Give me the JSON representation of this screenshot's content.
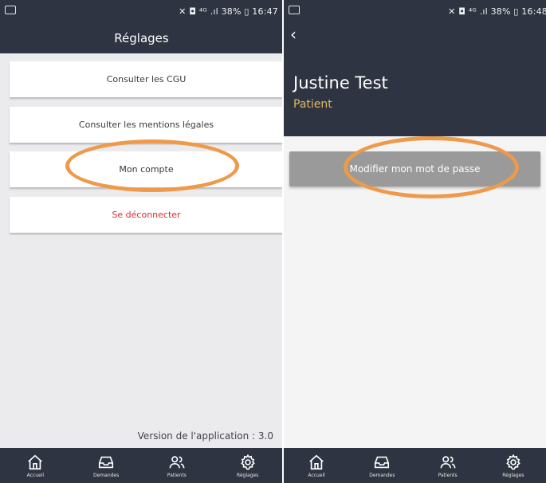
{
  "left": {
    "status": {
      "right": "✕ ◘ ⁴ᴳ .ıl 38% ▯ 16:47"
    },
    "title": "Réglages",
    "menu": [
      {
        "label": "Consulter les CGU"
      },
      {
        "label": "Consulter les mentions légales"
      },
      {
        "label": "Mon compte"
      },
      {
        "label": "Se déconnecter",
        "color": "#e02a2a"
      }
    ],
    "version": "Version de l'application : 3.0",
    "tabs": [
      {
        "label": "Accueil",
        "icon": "home-icon"
      },
      {
        "label": "Demandes",
        "icon": "inbox-icon"
      },
      {
        "label": "Patients",
        "icon": "users-icon"
      },
      {
        "label": "Réglages",
        "icon": "gear-icon"
      }
    ]
  },
  "right": {
    "status": {
      "right": "✕ ◘ ⁴ᴳ .ıl 38% ▯ 16:48"
    },
    "back": "‹",
    "profile": {
      "name": "Justine Test",
      "role": "Patient"
    },
    "password_button": "Modifier mon mot de passe",
    "tabs": [
      {
        "label": "Accueil",
        "icon": "home-icon"
      },
      {
        "label": "Demandes",
        "icon": "inbox-icon"
      },
      {
        "label": "Patients",
        "icon": "users-icon"
      },
      {
        "label": "Réglages",
        "icon": "gear-icon"
      }
    ]
  },
  "colors": {
    "bar": "#2e3442",
    "accent": "#e4b95a",
    "danger": "#e02a2a",
    "highlight": "#ef9a4a"
  }
}
